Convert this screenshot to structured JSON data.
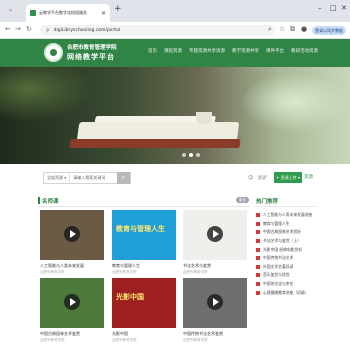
{
  "browser": {
    "tab_title": "云教学平台数字化校园服务",
    "new_tab": "+",
    "url": "digiLibryschooling.com/portal",
    "profile_label": "登录以同步数据"
  },
  "site": {
    "name_cn": "合肥市教育管理学院",
    "name_main": "网络教学平台",
    "nav": [
      "首页",
      "课程资源",
      "专题资源共享资源",
      "教学资源共享",
      "课件平台",
      "教研活动资源"
    ]
  },
  "banner": {
    "dots": 3,
    "active_dot": 1
  },
  "search": {
    "scope": "全部资源 ▾",
    "placeholder": "请输入搜索关键词",
    "user": "登录",
    "primary_button": "+ 资源上传 ▾",
    "link": "资源"
  },
  "sections": {
    "left_title": "名师课",
    "more_label": "更多",
    "right_title": "热门推荐"
  },
  "videos": [
    {
      "title": "人工智能与人类未来发展",
      "sub": "合肥市教育学院",
      "thumb": "#6b5a44",
      "thumb_text": ""
    },
    {
      "title": "教育与管理人生",
      "sub": "合肥市教育学院",
      "thumb": "#1f9ed8",
      "thumb_text": "教育与管理人生"
    },
    {
      "title": "书法艺术与鉴赏",
      "sub": "合肥市教育学院",
      "thumb": "#f1efeb",
      "thumb_text": ""
    },
    {
      "title": "中国古典园林艺术鉴赏",
      "sub": "合肥市教育学院",
      "thumb": "#4f7a3e",
      "thumb_text": ""
    },
    {
      "title": "光影中国",
      "sub": "合肥市教育学院",
      "thumb": "#9e1f1f",
      "thumb_text": "光影中国"
    },
    {
      "title": "中国传统书法艺术鉴赏",
      "sub": "合肥市教育学院",
      "thumb": "#6e6e6e",
      "thumb_text": ""
    }
  ],
  "hot": [
    "人工智能与人类未来发展讲座",
    "教育与管理人生",
    "中国古典园林艺术赏析",
    "书法艺术与鉴赏（上）",
    "光影中国·经典电影赏析",
    "中国传统书法艺术",
    "外国文学名著导读",
    "音乐鉴赏与欣赏",
    "中国茶文化与茶艺",
    "心理健康教育讲座（初级）"
  ]
}
